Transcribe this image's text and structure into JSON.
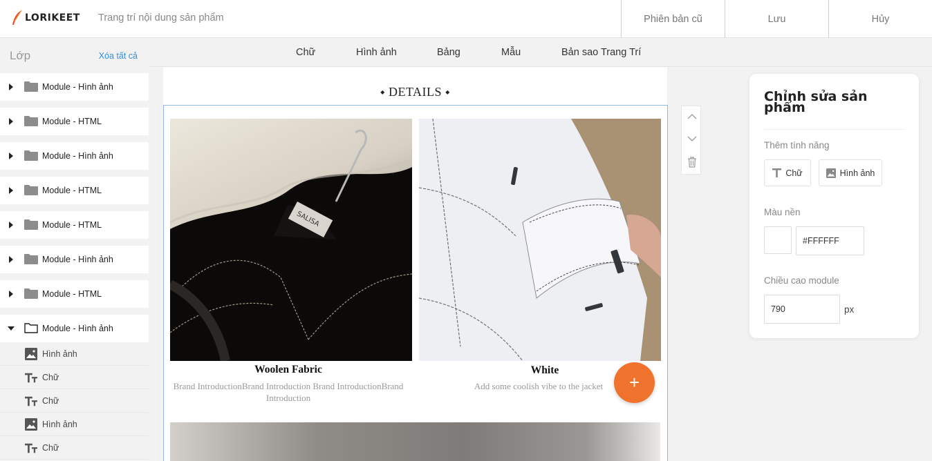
{
  "app": {
    "logo_text": "LORIKEET",
    "page_title": "Trang trí nội dung sản phẩm",
    "accent_color": "#f0732d",
    "link_color": "#2e8ee6"
  },
  "top_actions": {
    "old_version": "Phiên bản cũ",
    "save": "Lưu",
    "cancel": "Hủy"
  },
  "toolbar": {
    "items": [
      "Chữ",
      "Hình ảnh",
      "Bảng",
      "Mẫu",
      "Bản sao Trang Trí"
    ]
  },
  "layers": {
    "title": "Lớp",
    "clear_all": "Xóa tất cả",
    "modules": [
      {
        "label": "Module - Hình ảnh",
        "expanded": false
      },
      {
        "label": "Module - HTML",
        "expanded": false
      },
      {
        "label": "Module - Hình ảnh",
        "expanded": false
      },
      {
        "label": "Module - HTML",
        "expanded": false
      },
      {
        "label": "Module - HTML",
        "expanded": false
      },
      {
        "label": "Module - Hình ảnh",
        "expanded": false
      },
      {
        "label": "Module - HTML",
        "expanded": false
      },
      {
        "label": "Module - Hình ảnh",
        "expanded": true
      }
    ],
    "children": [
      {
        "icon": "image-icon",
        "label": "Hình ảnh"
      },
      {
        "icon": "text-icon",
        "label": "Chữ"
      },
      {
        "icon": "text-icon",
        "label": "Chữ"
      },
      {
        "icon": "image-icon",
        "label": "Hình ảnh"
      },
      {
        "icon": "text-icon",
        "label": "Chữ"
      }
    ]
  },
  "canvas": {
    "section_title": "⬩ DETAILS ⬩",
    "products": [
      {
        "title": "Woolen Fabric",
        "description": "Brand IntroductionBrand Introduction Brand IntroductionBrand Introduction"
      },
      {
        "title": "White",
        "description": "Add some coolish vibe to the jacket"
      }
    ],
    "fab_symbol": "+"
  },
  "editor": {
    "title": "Chỉnh sửa sản phẩm",
    "add_feature_label": "Thêm tính năng",
    "add_text_button": "Chữ",
    "add_image_button": "Hình ảnh",
    "background_color_label": "Màu nền",
    "background_color_value": "#FFFFFF",
    "module_height_label": "Chiều cao module",
    "module_height_value": "790",
    "module_height_unit": "px"
  }
}
